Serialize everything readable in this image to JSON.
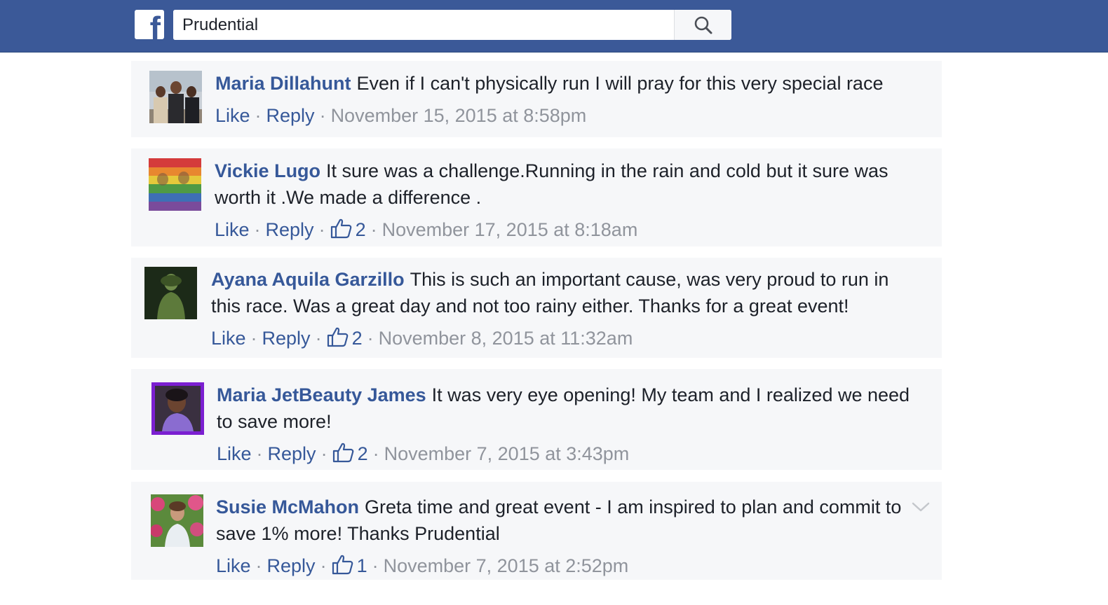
{
  "header": {
    "logo_letter": "f",
    "search_value": "Prudential"
  },
  "actions": {
    "like": "Like",
    "reply": "Reply",
    "separator": "·"
  },
  "comments": [
    {
      "author": "Maria Dillahunt",
      "text": "Even if I can't physically run I will pray for this very special race",
      "likes": null,
      "timestamp": "November 15, 2015 at 8:58pm"
    },
    {
      "author": "Vickie Lugo",
      "text": "It sure was a challenge.Running in the rain and cold but it sure was worth it .We made a difference .",
      "likes": "2",
      "timestamp": "November 17, 2015 at 8:18am"
    },
    {
      "author": "Ayana Aquila Garzillo",
      "text": "This is such an important cause, was very proud to run in this race. Was a great day and not too rainy either. Thanks for a great event!",
      "likes": "2",
      "timestamp": "November 8, 2015 at 11:32am"
    },
    {
      "author": "Maria JetBeauty James",
      "text": "It was very eye opening! My team and I realized we need to save more!",
      "likes": "2",
      "timestamp": "November 7, 2015 at 3:43pm"
    },
    {
      "author": "Susie McMahon",
      "text": "Greta time and great event - I am inspired to plan and commit to save 1% more! Thanks Prudential",
      "likes": "1",
      "timestamp": "November 7, 2015 at 2:52pm"
    }
  ],
  "colors": {
    "header_blue": "#3b5998",
    "link_blue": "#365899",
    "text": "#1d2129",
    "meta_gray": "#90949c",
    "comment_bg": "#f6f7f9"
  }
}
